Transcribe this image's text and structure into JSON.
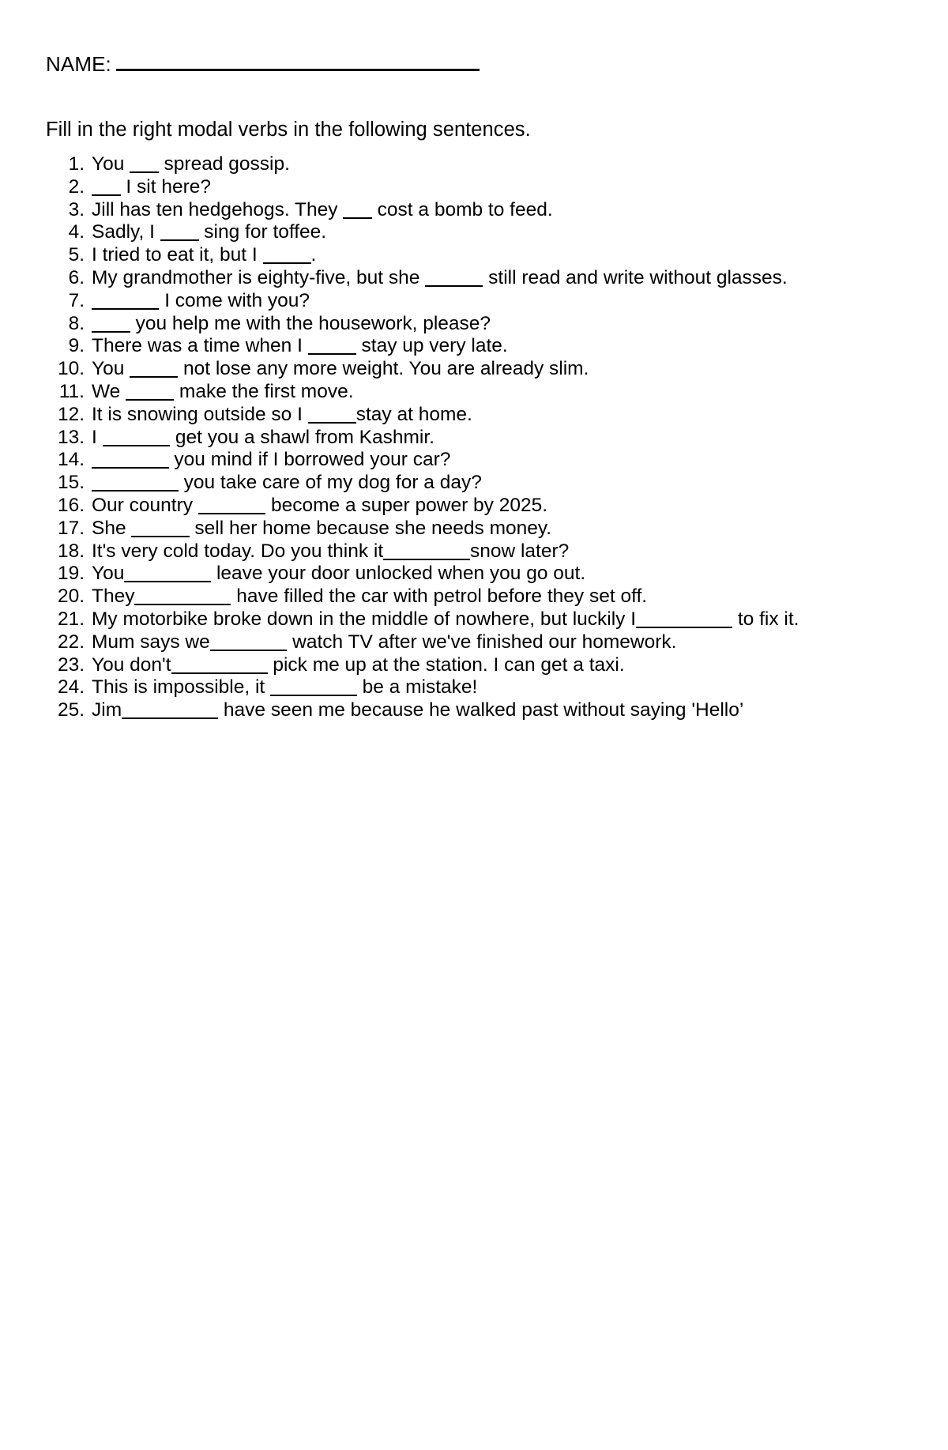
{
  "document": {
    "name_field": {
      "label": "NAME:",
      "value": "",
      "placeholder": ""
    },
    "instruction": "Fill in the right modal verbs in the following sentences.",
    "questions": [
      {
        "number": "1.",
        "text": "You ___ spread gossip."
      },
      {
        "number": "2.",
        "text": "___ I sit here?"
      },
      {
        "number": "3.",
        "text": "Jill has ten hedgehogs. They ___ cost a bomb to feed."
      },
      {
        "number": "4.",
        "text": "Sadly, I ____ sing for toffee."
      },
      {
        "number": "5.",
        "text": "I tried to eat it, but I _____."
      },
      {
        "number": "6.",
        "text": "My grandmother is eighty-five, but she ______ still read and write without glasses."
      },
      {
        "number": "7.",
        "text": "_______ I come with you?"
      },
      {
        "number": "8.",
        "text": "____ you help me with the housework, please?"
      },
      {
        "number": "9.",
        "text": "There was a time when I _____ stay up very late."
      },
      {
        "number": "10.",
        "text": "You _____ not lose any more weight. You are already slim."
      },
      {
        "number": "11.",
        "text": "We _____ make the first move."
      },
      {
        "number": "12.",
        "text": "It is snowing outside so I _____stay at home."
      },
      {
        "number": "13.",
        "text": "I _______ get you a shawl from Kashmir."
      },
      {
        "number": "14.",
        "text": "________ you mind if I borrowed your car?"
      },
      {
        "number": "15.",
        "text": "_________ you take care of my dog for a day?"
      },
      {
        "number": "16.",
        "text": "Our country _______ become a super power by 2025."
      },
      {
        "number": "17.",
        "text": "She ______ sell her home because she needs money."
      },
      {
        "number": "18.",
        "text": "It's very cold today. Do you think it_________snow later?"
      },
      {
        "number": "19.",
        "text": "You_________ leave your door unlocked when you go out."
      },
      {
        "number": "20.",
        "text": "They__________ have filled the car with petrol before they set off."
      },
      {
        "number": "21.",
        "text": "My motorbike broke down in the middle of nowhere, but luckily I__________ to fix it."
      },
      {
        "number": "22.",
        "text": "Mum says we________ watch TV after we've finished our homework."
      },
      {
        "number": "23.",
        "text": "You don't__________ pick me up at the station. I can get a taxi."
      },
      {
        "number": "24.",
        "text": "This is impossible, it _________ be a mistake!"
      },
      {
        "number": "25.",
        "text": "Jim__________ have seen me because he walked past without saying 'Hello’"
      }
    ]
  },
  "colors": {
    "page_background": "#ffffff",
    "text": "#000000",
    "rule": "#000000"
  }
}
